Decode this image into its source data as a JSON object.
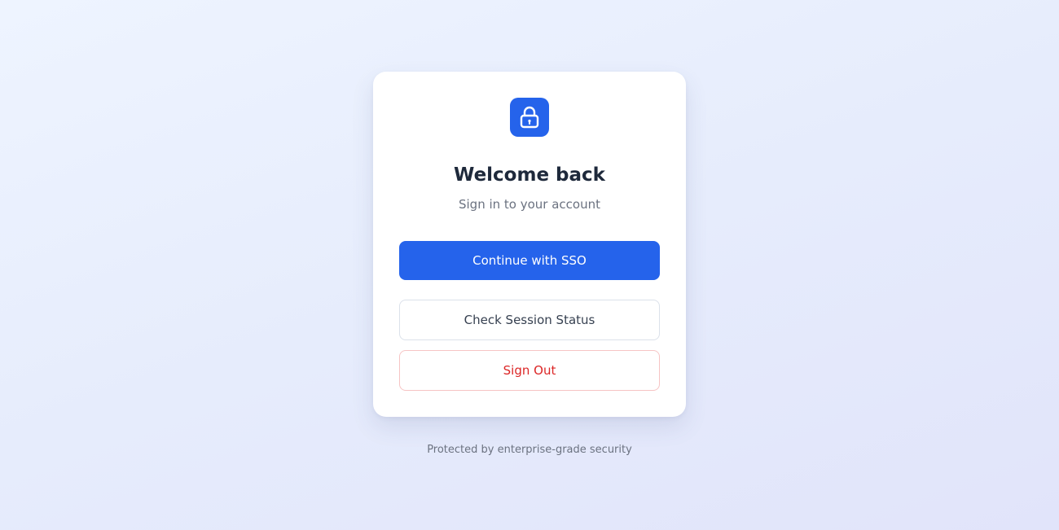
{
  "icon": "lock-icon",
  "colors": {
    "accent": "#2563eb",
    "danger": "#dc2626",
    "title": "#1e293b",
    "muted": "#6b7280"
  },
  "card": {
    "title": "Welcome back",
    "subtitle": "Sign in to your account"
  },
  "actions": {
    "sso_label": "Continue with SSO",
    "status_label": "Check Session Status",
    "signout_label": "Sign Out"
  },
  "footer": {
    "text": "Protected by enterprise-grade security"
  }
}
